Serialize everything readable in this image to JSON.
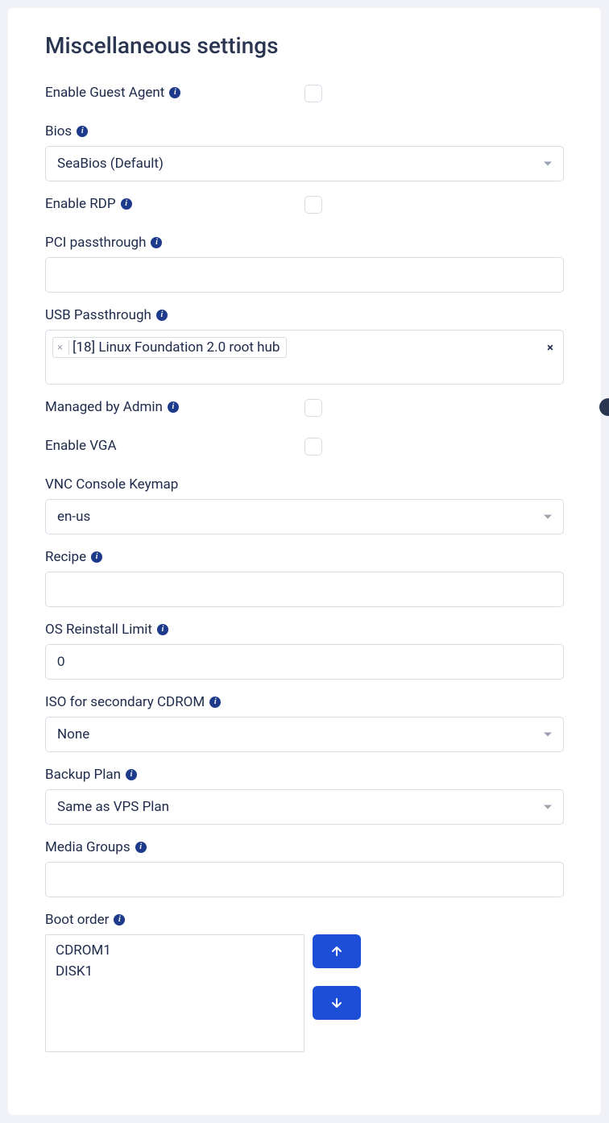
{
  "title": "Miscellaneous settings",
  "fields": {
    "guest_agent": {
      "label": "Enable Guest Agent"
    },
    "bios": {
      "label": "Bios",
      "value": "SeaBios (Default)"
    },
    "rdp": {
      "label": "Enable RDP"
    },
    "pci": {
      "label": "PCI passthrough",
      "value": ""
    },
    "usb": {
      "label": "USB Passthrough",
      "tag": "[18] Linux Foundation 2.0 root hub"
    },
    "managed": {
      "label": "Managed by Admin"
    },
    "vga": {
      "label": "Enable VGA"
    },
    "vnc": {
      "label": "VNC Console Keymap",
      "value": "en-us"
    },
    "recipe": {
      "label": "Recipe",
      "value": ""
    },
    "reinstall": {
      "label": "OS Reinstall Limit",
      "value": "0"
    },
    "iso": {
      "label": "ISO for secondary CDROM",
      "value": "None"
    },
    "backup": {
      "label": "Backup Plan",
      "value": "Same as VPS Plan"
    },
    "media": {
      "label": "Media Groups",
      "value": ""
    },
    "boot": {
      "label": "Boot order",
      "items": [
        "CDROM1",
        "DISK1"
      ]
    }
  }
}
